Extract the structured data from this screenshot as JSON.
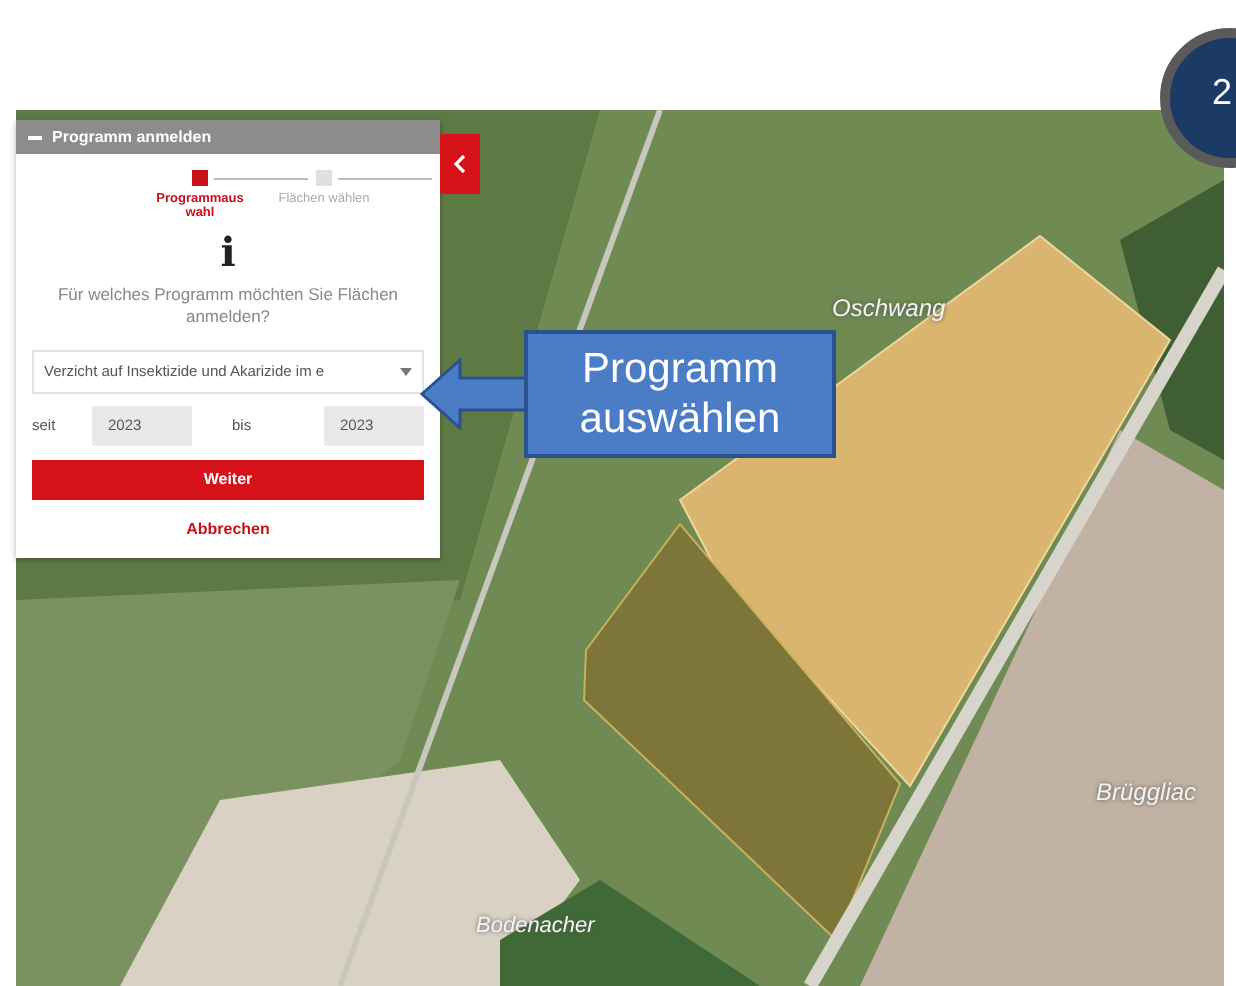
{
  "slide": {
    "step_badge": "2"
  },
  "map": {
    "place_labels": [
      {
        "name": "Oschwang",
        "kind": "upper"
      },
      {
        "name": "Brüggliac",
        "kind": "right"
      },
      {
        "name": "Bodenacher",
        "kind": "bottom"
      }
    ]
  },
  "panel": {
    "title": "Programm anmelden",
    "steps": [
      {
        "label": "Programmauswahl",
        "selected": true
      },
      {
        "label": "Flächen wählen",
        "selected": false
      }
    ],
    "info_symbol": "i",
    "question": "Für welches Programm möchten Sie Flächen anmelden?",
    "program_select": {
      "value": "Verzicht auf Insektizide und Akarizide im e"
    },
    "from_label": "seit",
    "from_value": "2023",
    "to_label": "bis",
    "to_value": "2023",
    "buttons": [
      {
        "label": "Weiter",
        "kind": "primary"
      },
      {
        "label": "Abbrechen",
        "kind": "link"
      }
    ]
  },
  "callout": {
    "text": "Programm auswählen"
  }
}
